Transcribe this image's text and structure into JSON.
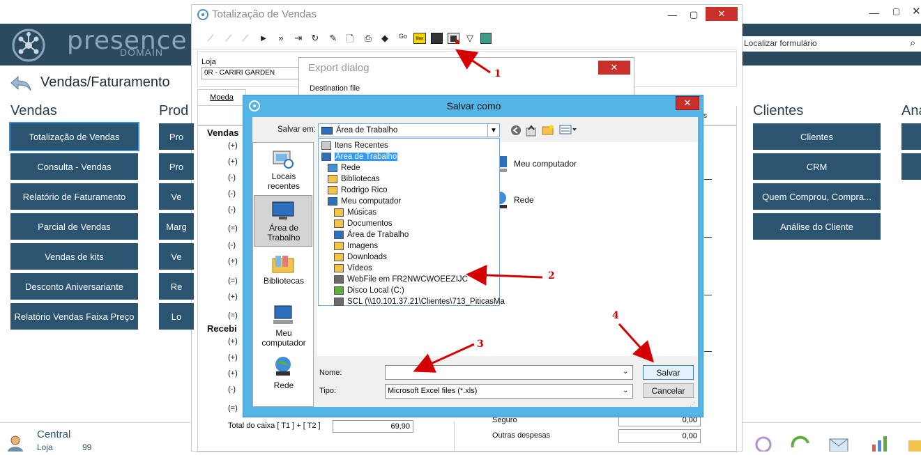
{
  "app": {
    "brand": "presence",
    "brand_sub": "DOMAIN",
    "page_title": "Vendas/Faturamento",
    "search_placeholder": "Localizar formulário",
    "sections": {
      "vendas": {
        "title": "Vendas",
        "items": [
          "Totalização de Vendas",
          "Consulta - Vendas",
          "Relatório de Faturamento",
          "Parcial de Vendas",
          "Vendas de kits",
          "Desconto Aniversariante",
          "Relatório Vendas Faixa Preço"
        ]
      },
      "produtos": {
        "title": "Prod",
        "items": [
          "Pro",
          "Pro",
          "Ve",
          "Marg",
          "Ve",
          "Re",
          "Lo"
        ]
      },
      "clientes": {
        "title": "Clientes",
        "items": [
          "Clientes",
          "CRM",
          "Quem Comprou, Compra...",
          "Análise do Cliente"
        ]
      },
      "analise": {
        "title": "Ana"
      }
    },
    "footer": {
      "central": "Central",
      "loja_label": "Loja",
      "loja_value": "99"
    }
  },
  "totalizacao": {
    "title": "Totalização de Vendas",
    "loja_label": "Loja",
    "loja_value": "0R - CARIRI GARDEN",
    "tab_moeda": "Moeda",
    "tab_s": "s",
    "vendas_label": "Vendas",
    "recebi_label": "Recebi",
    "signs_top": [
      "(+)",
      "(+)",
      "(-)",
      "(-)",
      "(-)",
      "(=)",
      "(-)",
      "(+)",
      "(=)",
      "(+)",
      "(=)"
    ],
    "signs_bottom": [
      "(+)",
      "(+)",
      "(+)",
      "(-)",
      "(=)"
    ],
    "total_caixa_label": "Total do caixa [ T1 ] + [ T2 ]",
    "total_caixa_value": "69,90",
    "seguro_label": "Seguro",
    "seguro_value": "0,00",
    "outras_label": "Outras despesas",
    "outras_value": "0,00"
  },
  "export_dialog": {
    "title": "Export dialog",
    "destination_label": "Destination file"
  },
  "save_dialog": {
    "title": "Salvar como",
    "salvar_em_label": "Salvar em:",
    "salvar_em_value": "Área de Trabalho",
    "places": [
      "Locais recentes",
      "Área de Trabalho",
      "Bibliotecas",
      "Meu computador",
      "Rede"
    ],
    "tree": [
      {
        "label": "Itens Recentes",
        "indent": 0,
        "icon": "recent-icon"
      },
      {
        "label": "Área de Trabalho",
        "indent": 0,
        "icon": "desktop-icon",
        "selected": true
      },
      {
        "label": "Rede",
        "indent": 1,
        "icon": "network-icon"
      },
      {
        "label": "Bibliotecas",
        "indent": 1,
        "icon": "library-icon"
      },
      {
        "label": "Rodrigo Rico",
        "indent": 1,
        "icon": "user-folder-icon"
      },
      {
        "label": "Meu computador",
        "indent": 1,
        "icon": "computer-icon"
      },
      {
        "label": "Músicas",
        "indent": 2,
        "icon": "music-folder-icon"
      },
      {
        "label": "Documentos",
        "indent": 2,
        "icon": "documents-folder-icon"
      },
      {
        "label": "Área de Trabalho",
        "indent": 2,
        "icon": "desktop-icon"
      },
      {
        "label": "Imagens",
        "indent": 2,
        "icon": "pictures-folder-icon"
      },
      {
        "label": "Downloads",
        "indent": 2,
        "icon": "downloads-folder-icon"
      },
      {
        "label": "Vídeos",
        "indent": 2,
        "icon": "videos-folder-icon"
      },
      {
        "label": "WebFile em FR2NWCWOEEZIJC",
        "indent": 2,
        "icon": "network-drive-icon"
      },
      {
        "label": "Disco Local (C:)",
        "indent": 2,
        "icon": "local-disk-icon"
      },
      {
        "label": "SCL (\\\\10.101.37.21\\Clientes\\713_PiticasMa",
        "indent": 2,
        "icon": "network-drive-icon"
      }
    ],
    "main_items": [
      "Meu computador",
      "Rede"
    ],
    "nome_label": "Nome:",
    "nome_value": "",
    "tipo_label": "Tipo:",
    "tipo_value": "Microsoft Excel files (*.xls)",
    "salvar_button": "Salvar",
    "cancelar_button": "Cancelar"
  },
  "annotations": [
    "1",
    "2",
    "3",
    "4"
  ],
  "colors": {
    "banner": "#2c4a5e",
    "tile": "#2b5470",
    "dialog_frame": "#55b4e6",
    "close_red": "#c9302c",
    "annotation_red": "#d40000",
    "selection_blue": "#3399ff"
  }
}
